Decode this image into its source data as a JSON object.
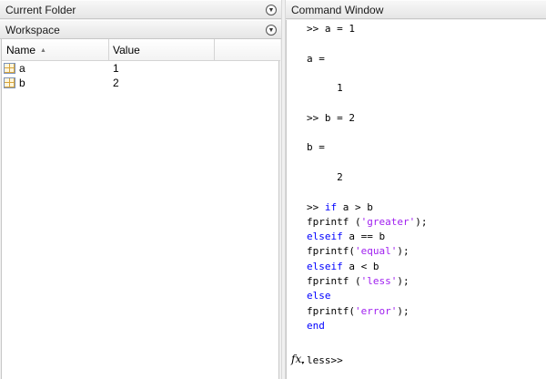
{
  "current_folder": {
    "title": "Current Folder",
    "menu_icon": "chevron-down-icon"
  },
  "workspace": {
    "title": "Workspace",
    "menu_icon": "chevron-down-icon",
    "columns": {
      "name": "Name",
      "value": "Value"
    },
    "sort_indicator": "▲",
    "variables": [
      {
        "name": "a",
        "value": "1"
      },
      {
        "name": "b",
        "value": "2"
      }
    ]
  },
  "command_window": {
    "title": "Command Window",
    "lines": [
      [
        {
          "t": ">> a = 1"
        }
      ],
      [
        {
          "t": ""
        }
      ],
      [
        {
          "t": "a ="
        }
      ],
      [
        {
          "t": ""
        }
      ],
      [
        {
          "t": "     1"
        }
      ],
      [
        {
          "t": ""
        }
      ],
      [
        {
          "t": ">> b = 2"
        }
      ],
      [
        {
          "t": ""
        }
      ],
      [
        {
          "t": "b ="
        }
      ],
      [
        {
          "t": ""
        }
      ],
      [
        {
          "t": "     2"
        }
      ],
      [
        {
          "t": ""
        }
      ],
      [
        {
          "t": ">> "
        },
        {
          "t": "if",
          "c": "kw"
        },
        {
          "t": " a > b"
        }
      ],
      [
        {
          "t": "fprintf ("
        },
        {
          "t": "'greater'",
          "c": "str"
        },
        {
          "t": ");"
        }
      ],
      [
        {
          "t": "elseif",
          "c": "kw"
        },
        {
          "t": " a == b"
        }
      ],
      [
        {
          "t": "fprintf("
        },
        {
          "t": "'equal'",
          "c": "str"
        },
        {
          "t": ");"
        }
      ],
      [
        {
          "t": "elseif",
          "c": "kw"
        },
        {
          "t": " a < b"
        }
      ],
      [
        {
          "t": "fprintf ("
        },
        {
          "t": "'less'",
          "c": "str"
        },
        {
          "t": ");"
        }
      ],
      [
        {
          "t": "else",
          "c": "kw"
        }
      ],
      [
        {
          "t": "fprintf("
        },
        {
          "t": "'error'",
          "c": "str"
        },
        {
          "t": ");"
        }
      ],
      [
        {
          "t": "end",
          "c": "kw"
        }
      ]
    ],
    "output_prompt": "less>>",
    "fx_label": "fx",
    "fx_caret": "▾"
  },
  "colors": {
    "keyword": "#0000ff",
    "string": "#a020f0"
  }
}
